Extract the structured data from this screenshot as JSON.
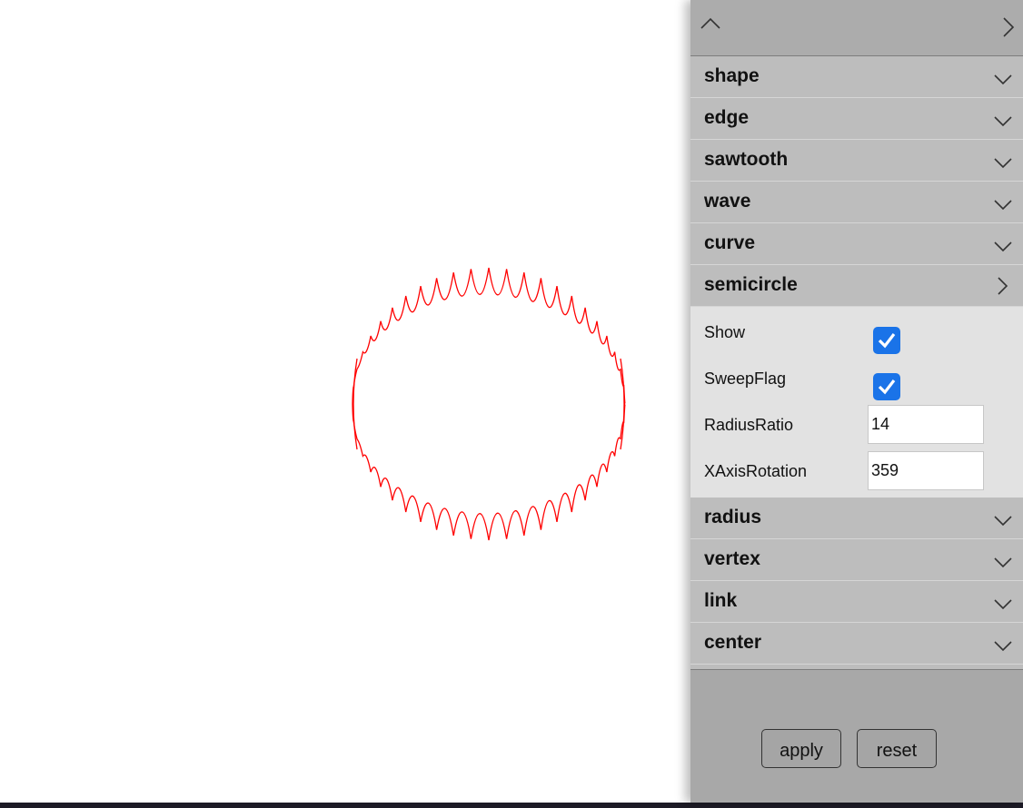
{
  "panel": {
    "top_icons": [
      "chevron-up-icon",
      "chevron-right-icon"
    ],
    "sections": [
      {
        "label": "shape",
        "state": "collapsed"
      },
      {
        "label": "edge",
        "state": "collapsed"
      },
      {
        "label": "sawtooth",
        "state": "collapsed"
      },
      {
        "label": "wave",
        "state": "collapsed"
      },
      {
        "label": "curve",
        "state": "collapsed"
      },
      {
        "label": "semicircle",
        "state": "expanded"
      },
      {
        "label": "radius",
        "state": "collapsed"
      },
      {
        "label": "vertex",
        "state": "collapsed"
      },
      {
        "label": "link",
        "state": "collapsed"
      },
      {
        "label": "center",
        "state": "collapsed"
      }
    ],
    "semicircle": {
      "show_label": "Show",
      "show_checked": true,
      "sweepflag_label": "SweepFlag",
      "sweepflag_checked": true,
      "radiusratio_label": "RadiusRatio",
      "radiusratio_value": "14",
      "xaxisrotation_label": "XAxisRotation",
      "xaxisrotation_value": "359"
    },
    "apply_label": "apply",
    "reset_label": "reset"
  },
  "colors": {
    "stroke": "#ff0000",
    "checkbox": "#1a73e8",
    "panel_bg": "#a8a8a8",
    "section_bg": "#bdbdbd",
    "body_bg": "#e2e2e2"
  }
}
